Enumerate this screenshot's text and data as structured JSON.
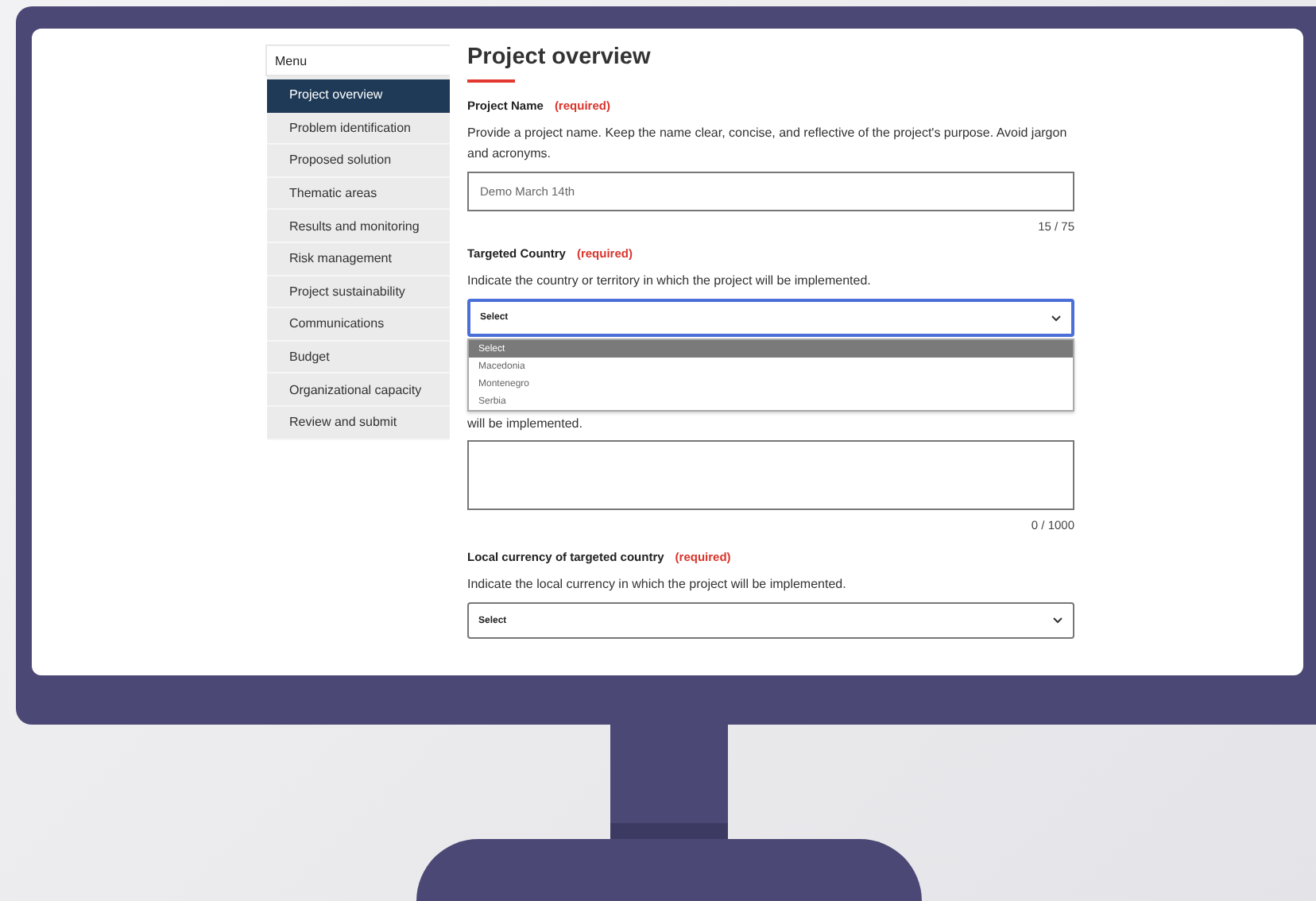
{
  "menu": {
    "title": "Menu",
    "items": [
      {
        "label": "Project overview",
        "selected": true
      },
      {
        "label": "Problem identification",
        "selected": false
      },
      {
        "label": "Proposed solution",
        "selected": false
      },
      {
        "label": "Thematic areas",
        "selected": false
      },
      {
        "label": "Results and monitoring",
        "selected": false
      },
      {
        "label": "Risk management",
        "selected": false
      },
      {
        "label": "Project sustainability",
        "selected": false
      },
      {
        "label": "Communications",
        "selected": false
      },
      {
        "label": "Budget",
        "selected": false
      },
      {
        "label": "Organizational capacity",
        "selected": false
      },
      {
        "label": "Review and submit",
        "selected": false
      }
    ]
  },
  "page_title": "Project overview",
  "fields": [
    {
      "kind": "text",
      "label": "Project Name",
      "required": "(required)",
      "description": "Provide a project name. Keep the name clear, concise, and reflective of the project's purpose. Avoid jargon and acronyms.",
      "value": "Demo March 14th",
      "counter": "15 / 75"
    },
    {
      "kind": "select",
      "label": "Targeted Country",
      "required": "(required)",
      "description": "Indicate the country or territory in which the project will be implemented.",
      "value": "Select",
      "focused": true,
      "expanded": true,
      "options": [
        {
          "label": "Select",
          "selected": true
        },
        {
          "label": "Macedonia",
          "selected": false
        },
        {
          "label": "Montenegro",
          "selected": false
        },
        {
          "label": "Serbia",
          "selected": false
        }
      ]
    },
    {
      "kind": "textarea",
      "description": "will be implemented.",
      "counter": "0 / 1000"
    },
    {
      "kind": "select",
      "label": "Local currency of targeted country",
      "required": "(required)",
      "description": "Indicate the local currency in which the project will be implemented.",
      "value": "Select",
      "focused": false
    }
  ]
}
